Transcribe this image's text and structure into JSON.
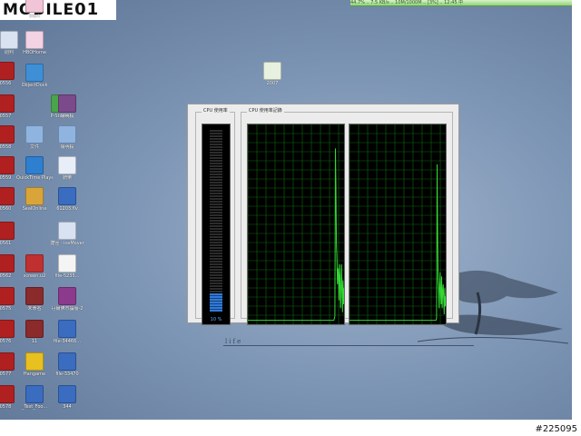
{
  "logo": {
    "text": "MOBILE",
    "suffix": "01"
  },
  "top_strip": {
    "text": "44.7%  ..  7.5 KB/s  ..  10M/1000M  ..  [3%]  ..  12:45 中"
  },
  "desktop_icons": [
    {
      "label": "Start",
      "color": "#f1c4d8"
    },
    {
      "label": "HBOHome",
      "color": "#f3d2e4"
    },
    {
      "label": "ObjectDock",
      "color": "#3f8fd6"
    },
    {
      "label": "P-Studio",
      "color": "#4aa54a"
    },
    {
      "label": "陽明殺",
      "color": "#7a4a8a"
    },
    {
      "label": "文件",
      "color": "#8fb4e0"
    },
    {
      "label": "陽明殺",
      "color": "#8fb4e0"
    },
    {
      "label": "QuickTime Player",
      "color": "#2e7fd0"
    },
    {
      "label": "騎樂",
      "color": "#e8eef8"
    },
    {
      "label": "SealOnline",
      "color": "#d9a43a"
    },
    {
      "label": "61203.flv",
      "color": "#3a6cc0"
    },
    {
      "label": "捷徑 - iceMover",
      "color": "#d8e2f0"
    },
    {
      "label": "screen.u2",
      "color": "#c03030"
    },
    {
      "label": "file-5235...",
      "color": "#f4f4f4"
    },
    {
      "label": "未命名",
      "color": "#8a2a2a"
    },
    {
      "label": "丹爾佛市論壇-2",
      "color": "#8c3a8c"
    },
    {
      "label": "11",
      "color": "#8a2a2a"
    },
    {
      "label": "file-34466...",
      "color": "#3a6cc0"
    },
    {
      "label": "Hangame",
      "color": "#e8c020"
    },
    {
      "label": "file-33470",
      "color": "#3a6cc0"
    },
    {
      "label": "_Test_Foo...",
      "color": "#3a6cc0"
    },
    {
      "label": "344",
      "color": "#3a6cc0"
    },
    {
      "label": "2007",
      "color": "#e8f0e0"
    },
    {
      "label": "削判",
      "color": "#d8e2f0"
    },
    {
      "label": "0556",
      "color": "#b02020"
    },
    {
      "label": "0557",
      "color": "#b02020"
    },
    {
      "label": "0558",
      "color": "#b02020"
    },
    {
      "label": "0559",
      "color": "#b02020"
    },
    {
      "label": "0560",
      "color": "#b02020"
    },
    {
      "label": "0561",
      "color": "#b02020"
    },
    {
      "label": "0562",
      "color": "#b02020"
    },
    {
      "label": "0575",
      "color": "#b02020"
    },
    {
      "label": "0576",
      "color": "#b02020"
    },
    {
      "label": "0577",
      "color": "#b02020"
    },
    {
      "label": "0578",
      "color": "#b02020"
    }
  ],
  "cpu_window": {
    "usage_title": "CPU 使用率",
    "history_title": "CPU 使用率記錄",
    "usage_value": 10,
    "usage_label": "10 %",
    "accent": "#2f7bd8",
    "graph_color": "#33d933",
    "grid_color": "#0d6a0d",
    "history": [
      [
        2,
        2,
        2,
        2,
        2,
        2,
        2,
        2,
        2,
        2,
        2,
        2,
        2,
        2,
        2,
        2,
        2,
        2,
        2,
        2,
        2,
        2,
        2,
        2,
        2,
        2,
        2,
        2,
        2,
        2,
        2,
        2,
        2,
        2,
        2,
        2,
        2,
        2,
        2,
        2,
        2,
        2,
        2,
        2,
        2,
        2,
        2,
        2,
        2,
        2,
        2,
        2,
        2,
        2,
        2,
        2,
        2,
        2,
        2,
        2,
        2,
        2,
        2,
        2,
        2,
        2,
        2,
        2,
        2,
        2,
        2,
        2,
        2,
        2,
        2,
        2,
        2,
        2,
        2,
        2,
        2,
        2,
        2,
        2,
        2,
        2,
        2,
        2,
        2,
        2,
        2,
        2,
        2,
        2,
        2,
        2,
        2,
        2,
        2,
        2,
        2,
        2,
        2,
        2,
        2,
        2,
        2,
        2,
        2,
        2,
        2,
        2,
        2,
        2,
        2,
        2,
        2,
        2,
        2,
        2,
        2,
        2,
        2,
        2,
        2,
        2,
        2,
        2,
        2,
        2,
        2,
        2,
        2,
        2,
        2,
        2,
        2,
        2,
        2,
        2,
        2,
        2,
        2,
        2,
        2,
        2,
        2,
        2,
        2,
        2,
        2,
        2,
        2,
        2,
        2,
        2,
        2,
        2,
        2,
        2,
        2,
        2,
        2,
        2,
        2,
        2,
        2,
        2,
        2,
        2,
        3,
        4,
        88,
        70,
        40,
        34,
        20,
        28,
        25,
        12,
        30,
        24,
        8,
        14,
        30,
        18,
        6,
        22,
        10,
        18
      ],
      [
        2,
        2,
        2,
        2,
        2,
        2,
        2,
        2,
        2,
        2,
        2,
        2,
        2,
        2,
        2,
        2,
        2,
        2,
        2,
        2,
        2,
        2,
        2,
        2,
        2,
        2,
        2,
        2,
        2,
        2,
        2,
        2,
        2,
        2,
        2,
        2,
        2,
        2,
        2,
        2,
        2,
        2,
        2,
        2,
        2,
        2,
        2,
        2,
        2,
        2,
        2,
        2,
        2,
        2,
        2,
        2,
        2,
        2,
        2,
        2,
        2,
        2,
        2,
        2,
        2,
        2,
        2,
        2,
        2,
        2,
        2,
        2,
        2,
        2,
        2,
        2,
        2,
        2,
        2,
        2,
        2,
        2,
        2,
        2,
        2,
        2,
        2,
        2,
        2,
        2,
        2,
        2,
        2,
        2,
        2,
        2,
        2,
        2,
        2,
        2,
        2,
        2,
        2,
        2,
        2,
        2,
        2,
        2,
        2,
        2,
        2,
        2,
        2,
        2,
        2,
        2,
        2,
        2,
        2,
        2,
        2,
        2,
        2,
        2,
        2,
        2,
        2,
        2,
        2,
        2,
        2,
        2,
        2,
        2,
        2,
        2,
        2,
        2,
        2,
        2,
        2,
        2,
        2,
        2,
        2,
        2,
        2,
        2,
        2,
        2,
        2,
        2,
        2,
        2,
        2,
        2,
        2,
        2,
        2,
        2,
        2,
        2,
        2,
        2,
        2,
        2,
        2,
        2,
        2,
        2,
        2,
        3,
        80,
        50,
        22,
        18,
        8,
        20,
        26,
        15,
        10,
        24,
        8,
        16,
        20,
        12,
        5,
        18,
        9,
        14
      ]
    ]
  },
  "wallpaper": {
    "text": "life"
  },
  "image_id": "#225095"
}
